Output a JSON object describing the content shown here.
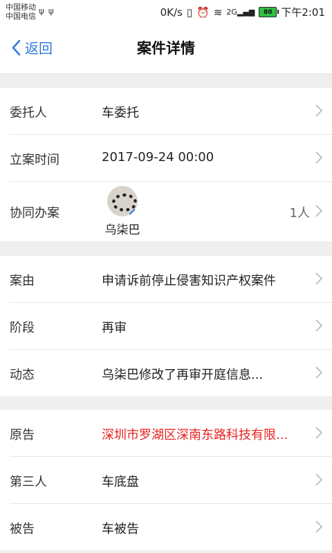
{
  "statusbar": {
    "carrier1": "中国移动",
    "carrier2": "中国电信",
    "usb": "ψψ",
    "speed": "0K/s",
    "network": "2G",
    "battery": "80",
    "time": "下午2:01"
  },
  "nav": {
    "back_label": "返回",
    "title": "案件详情"
  },
  "section1": [
    {
      "label": "委托人",
      "value": "车委托"
    },
    {
      "label": "立案时间",
      "value": "2017-09-24 00:00"
    }
  ],
  "collab": {
    "label": "协同办案",
    "member_name": "乌柒巴",
    "count": "1人"
  },
  "section2": [
    {
      "label": "案由",
      "value": "申请诉前停止侵害知识产权案件"
    },
    {
      "label": "阶段",
      "value": "再审"
    },
    {
      "label": "动态",
      "value": "乌柒巴修改了再审开庭信息..."
    }
  ],
  "section3": [
    {
      "label": "原告",
      "value": "深圳市罗湖区深南东路科技有限..."
    },
    {
      "label": "第三人",
      "value": "车底盘"
    },
    {
      "label": "被告",
      "value": "车被告"
    }
  ],
  "colors": {
    "accent": "#2d7bdc",
    "plaintiff": "#e82020"
  }
}
